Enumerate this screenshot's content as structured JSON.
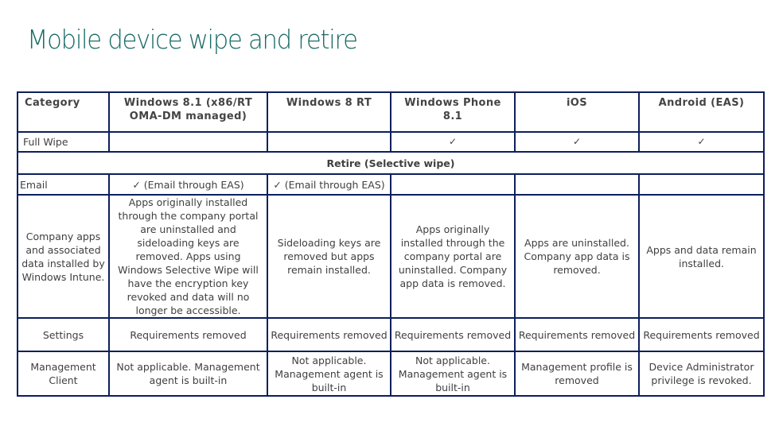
{
  "title": "Mobile device wipe and retire",
  "icons": {
    "check": "✓"
  },
  "colors": {
    "title": "#1a6b66",
    "border": "#0d1f5c",
    "text": "#404040"
  },
  "table": {
    "headers": [
      "Category",
      "Windows 8.1 (x86/RT OMA-DM managed)",
      "Windows 8 RT",
      "Windows Phone 8.1",
      "iOS",
      "Android (EAS)"
    ],
    "full_wipe": {
      "label": "Full Wipe",
      "cells": [
        "",
        "",
        "✓",
        "✓",
        "✓"
      ]
    },
    "retire_heading": "Retire (Selective wipe)",
    "email": {
      "label": "Email",
      "cells": [
        "✓ (Email through EAS)",
        "✓ (Email through EAS)",
        "",
        "",
        ""
      ]
    },
    "company_apps": {
      "label": "Company apps and associated data installed by Windows Intune.",
      "cells": [
        "Apps originally installed through the company portal are uninstalled and sideloading keys are removed. Apps using Windows Selective Wipe will have the encryption key revoked and data will no longer be accessible.",
        "Sideloading keys are removed but apps remain installed.",
        "Apps originally installed through the company portal are uninstalled. Company app data is removed.",
        "Apps are uninstalled. Company app data is removed.",
        "Apps and data remain installed."
      ]
    },
    "settings": {
      "label": "Settings",
      "cells": [
        "Requirements removed",
        "Requirements removed",
        "Requirements removed",
        "Requirements removed",
        "Requirements removed"
      ]
    },
    "management_client": {
      "label": "Management Client",
      "cells": [
        "Not applicable. Management agent is built-in",
        "Not applicable. Management agent is built-in",
        "Not applicable. Management agent is built-in",
        "Management profile is removed",
        "Device Administrator privilege is revoked."
      ]
    }
  }
}
